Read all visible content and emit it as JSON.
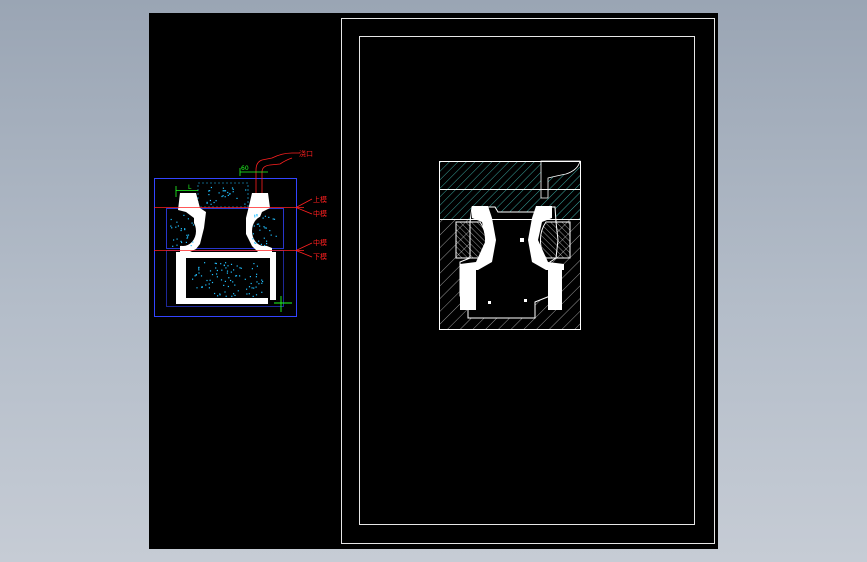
{
  "labels": {
    "gate": "浇口",
    "layers": [
      "上模",
      "中模",
      "中模",
      "下模"
    ],
    "dims": [
      "L",
      "60"
    ]
  },
  "colors": {
    "background": "#000000",
    "outline": "#ffffff",
    "cavity": "#ffffff",
    "hatch_teal": "#48d1c8",
    "frame_blue": "#3344ff",
    "dots": "#22c0ff",
    "leader": "#ff2020",
    "dimension": "#22ff22"
  },
  "icons": [
    "ucs-crosshair-icon"
  ]
}
